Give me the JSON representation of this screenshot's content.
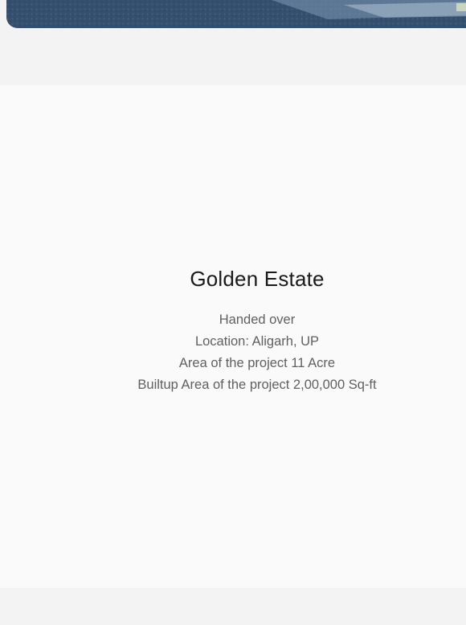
{
  "project": {
    "title": "Golden Estate",
    "details": [
      "Handed over",
      "Location: Aligarh, UP",
      "Area of the project 11 Acre",
      "Builtup Area of the project 2,00,000 Sq-ft"
    ]
  }
}
